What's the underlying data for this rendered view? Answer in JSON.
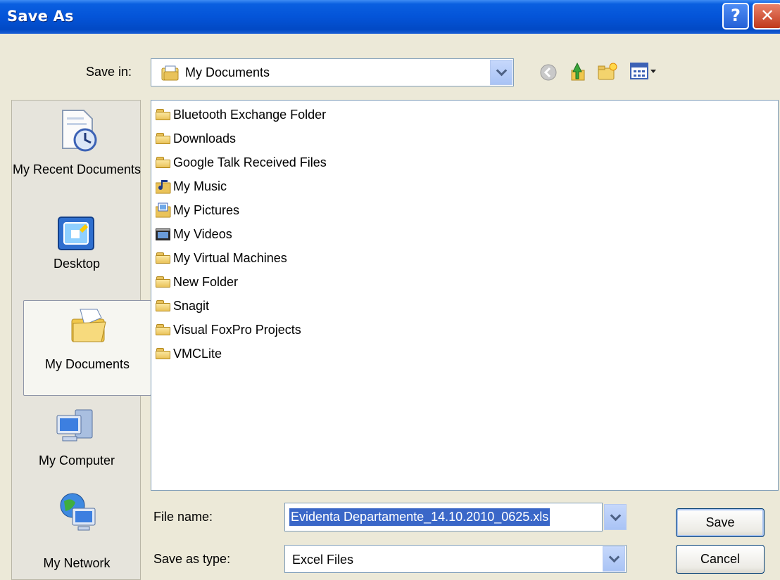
{
  "window": {
    "title": "Save As",
    "help_label": "?",
    "close_label": "✕"
  },
  "save_in": {
    "label": "Save in:",
    "value": "My Documents"
  },
  "toolbar": {
    "icons": [
      "back-icon",
      "up-folder-icon",
      "new-folder-icon",
      "views-menu-icon"
    ]
  },
  "places": [
    {
      "label": "My Recent Documents",
      "icon": "recent-documents-icon"
    },
    {
      "label": "Desktop",
      "icon": "desktop-icon"
    },
    {
      "label": "My Documents",
      "icon": "my-documents-icon",
      "selected": true
    },
    {
      "label": "My Computer",
      "icon": "my-computer-icon"
    },
    {
      "label": "My Network",
      "icon": "my-network-icon"
    }
  ],
  "files": [
    {
      "name": "Bluetooth Exchange Folder",
      "icon": "folder-icon"
    },
    {
      "name": "Downloads",
      "icon": "folder-icon"
    },
    {
      "name": "Google Talk Received Files",
      "icon": "folder-icon"
    },
    {
      "name": "My Music",
      "icon": "music-folder-icon"
    },
    {
      "name": "My Pictures",
      "icon": "pictures-folder-icon"
    },
    {
      "name": "My Videos",
      "icon": "videos-folder-icon"
    },
    {
      "name": "My Virtual Machines",
      "icon": "folder-icon"
    },
    {
      "name": "New Folder",
      "icon": "folder-icon"
    },
    {
      "name": "Snagit",
      "icon": "folder-icon"
    },
    {
      "name": "Visual FoxPro Projects",
      "icon": "folder-icon"
    },
    {
      "name": "VMCLite",
      "icon": "folder-icon"
    }
  ],
  "file_name": {
    "label": "File name:",
    "value": "Evidenta Departamente_14.10.2010_0625.xls"
  },
  "save_as_type": {
    "label": "Save as type:",
    "value": "Excel Files"
  },
  "buttons": {
    "save": "Save",
    "cancel": "Cancel"
  },
  "colors": {
    "title_bar": "#0454d8",
    "selection": "#3a67c8",
    "dialog_bg": "#ece9d8"
  }
}
